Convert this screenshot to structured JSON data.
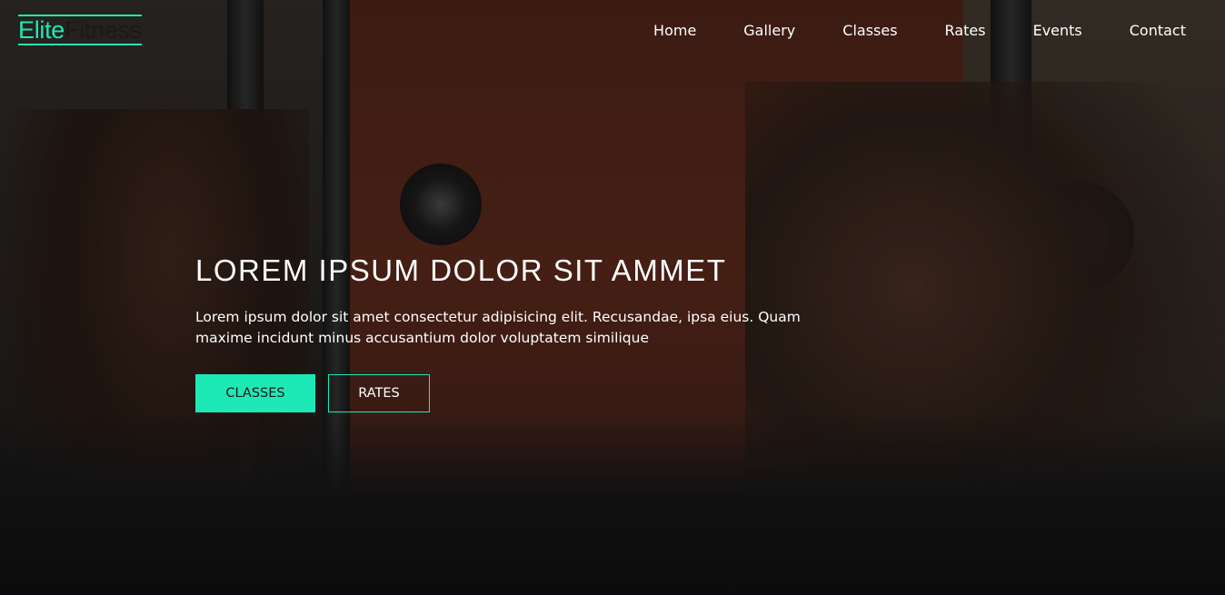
{
  "brand": {
    "logo_part1": "Elite",
    "logo_part2": "Fitness",
    "accent_color": "#1de9b6"
  },
  "nav": {
    "items": [
      {
        "label": "Home"
      },
      {
        "label": "Gallery"
      },
      {
        "label": "Classes"
      },
      {
        "label": "Rates"
      },
      {
        "label": "Events"
      },
      {
        "label": "Contact"
      }
    ]
  },
  "hero": {
    "title": "LOREM IPSUM DOLOR SIT AMMET",
    "text": "Lorem ipsum dolor sit amet consectetur adipisicing elit. Recusandae, ipsa eius. Quam maxime incidunt minus accusantium dolor voluptatem similique",
    "buttons": {
      "primary_label": "CLASSES",
      "secondary_label": "RATES"
    }
  }
}
